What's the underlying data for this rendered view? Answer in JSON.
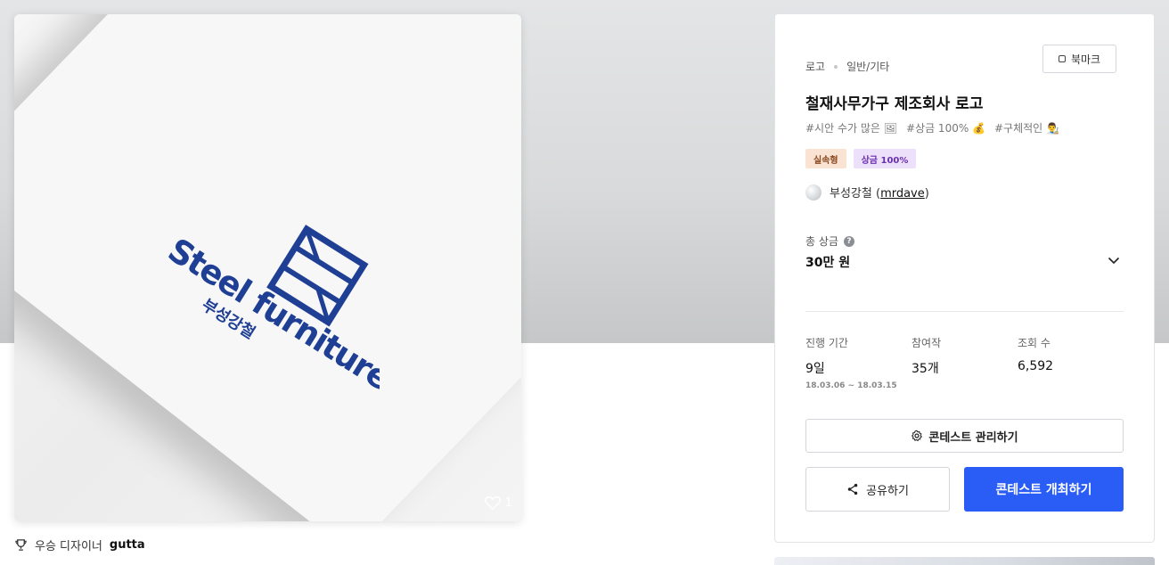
{
  "image": {
    "logo_text": "Steel furniture",
    "logo_subtext": "부성강철",
    "likes": "1",
    "brand_color": "#1f3f95"
  },
  "caption": {
    "prefix": "우승 디자이너",
    "designer": "gutta"
  },
  "panel": {
    "breadcrumb": [
      "로고",
      "일반/기타"
    ],
    "bookmark_label": "북마크",
    "title": "철재사무가구 제조회사 로고",
    "hashtags": [
      "#시안 수가 많은 🖼",
      "#상금 100% 💰",
      "#구체적인 👨‍🎨"
    ],
    "badges": [
      "실속형",
      "상금 100%"
    ],
    "owner": {
      "name": "부성강철",
      "handle": "mrdave"
    },
    "prize": {
      "label": "총 상금",
      "value": "30만 원"
    },
    "stats": [
      {
        "label": "진행 기간",
        "value": "9일",
        "sub": "18.03.06 ~ 18.03.15"
      },
      {
        "label": "참여작",
        "value": "35개",
        "sub": ""
      },
      {
        "label": "조회 수",
        "value": "6,592",
        "sub": ""
      }
    ],
    "manage_label": "콘테스트 관리하기",
    "share_label": "공유하기",
    "host_label": "콘테스트 개최하기"
  },
  "colors": {
    "primary": "#2a5cf6",
    "badge_orange_bg": "#fbe3d3",
    "badge_purple_bg": "#ece0fb"
  }
}
